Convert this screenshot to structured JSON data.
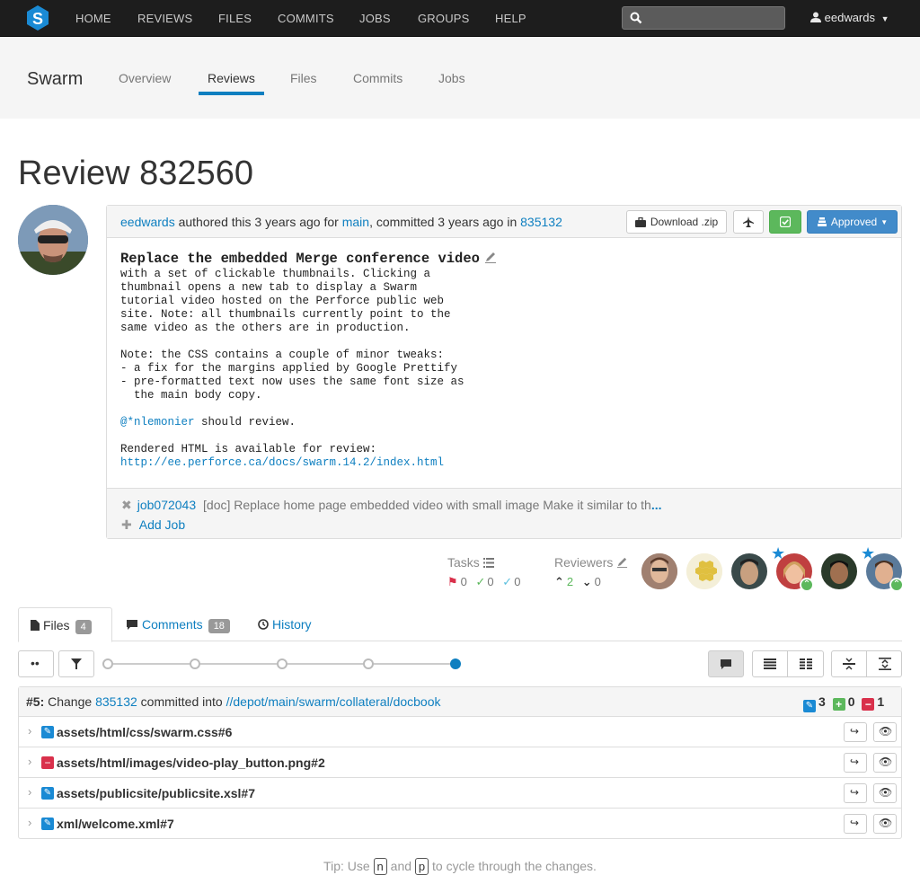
{
  "navbar": {
    "items": [
      "HOME",
      "REVIEWS",
      "FILES",
      "COMMITS",
      "JOBS",
      "GROUPS",
      "HELP"
    ],
    "search_placeholder": "",
    "user": "eedwards"
  },
  "project": {
    "name": "Swarm",
    "tabs": [
      "Overview",
      "Reviews",
      "Files",
      "Commits",
      "Jobs"
    ],
    "active_tab": "Reviews"
  },
  "review": {
    "title": "Review 832560",
    "author": "eedwards",
    "authored_text": " authored this 3 years ago for ",
    "branch": "main",
    "committed_text": ", committed 3 years ago in ",
    "change": "835132",
    "download_label": "Download .zip",
    "state_label": "Approved",
    "description_title": "Replace the embedded Merge conference video",
    "description_lines": [
      "with a set of clickable thumbnails. Clicking a",
      "thumbnail opens a new tab to display a Swarm",
      "tutorial video hosted on the Perforce public web",
      "site. Note: all thumbnails currently point to the",
      "same video as the others are in production.",
      "",
      "Note: the CSS contains a couple of minor tweaks:",
      "- a fix for the margins applied by Google Prettify",
      "- pre-formatted text now uses the same font size as",
      "  the main body copy."
    ],
    "mention": "@*nlemonier",
    "mention_suffix": " should review.",
    "rendered_line": "Rendered HTML is available for review:",
    "rendered_url": "http://ee.perforce.ca/docs/swarm.14.2/index.html",
    "job_id": "job072043",
    "job_desc": "[doc] Replace home page embedded video with small image Make it similar to th",
    "job_more": "...",
    "add_job_label": "Add Job"
  },
  "meta": {
    "tasks_label": "Tasks",
    "tasks_open": "0",
    "tasks_addressed": "0",
    "tasks_verified": "0",
    "reviewers_label": "Reviewers",
    "votes_up": "2",
    "votes_down": "0"
  },
  "tabs": {
    "files_label": "Files",
    "files_count": "4",
    "comments_label": "Comments",
    "comments_count": "18",
    "history_label": "History"
  },
  "files": {
    "header_prefix": "#5:",
    "header_change_text": " Change ",
    "header_change": "835132",
    "header_committed": " committed into ",
    "header_path": "//depot/main/swarm/collateral/docbook",
    "count_edit": "3",
    "count_add": "0",
    "count_delete": "1",
    "rows": [
      {
        "name": "assets/html/css/swarm.css#6",
        "action": "edit"
      },
      {
        "name": "assets/html/images/video-play_button.png#2",
        "action": "delete"
      },
      {
        "name": "assets/publicsite/publicsite.xsl#7",
        "action": "edit"
      },
      {
        "name": "xml/welcome.xml#7",
        "action": "edit"
      }
    ]
  },
  "tip": {
    "prefix": "Tip: Use ",
    "key1": "n",
    "middle": " and ",
    "key2": "p",
    "suffix": " to cycle through the changes."
  },
  "colors": {
    "link": "#0e7fc0",
    "navbar": "#1d1d1d",
    "edit": "#1a8ad4",
    "add": "#5cb85c",
    "delete": "#d9304b",
    "approved": "#428bca"
  }
}
